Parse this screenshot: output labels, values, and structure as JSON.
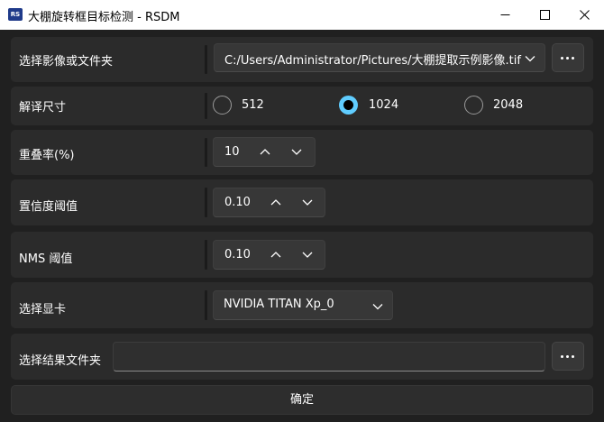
{
  "window": {
    "icon_text": "RS",
    "title": "大棚旋转框目标检测 - RSDM"
  },
  "image_row": {
    "label": "选择影像或文件夹",
    "path_value": "C:/Users/Administrator/Pictures/大棚提取示例影像.tif"
  },
  "resolution_row": {
    "label": "解译尺寸",
    "options": [
      "512",
      "1024",
      "2048"
    ],
    "selected": "1024"
  },
  "overlap_row": {
    "label": "重叠率(%)",
    "value": "10"
  },
  "confidence_row": {
    "label": "置信度阈值",
    "value": "0.10"
  },
  "nms_row": {
    "label": "NMS 阈值",
    "value": "0.10"
  },
  "gpu_row": {
    "label": "选择显卡",
    "value": "NVIDIA TITAN Xp_0"
  },
  "output_row": {
    "label": "选择结果文件夹",
    "value": ""
  },
  "confirm_button": {
    "label": "确定"
  },
  "colors": {
    "accent": "#60cdff",
    "background": "#202020",
    "row_background": "#2b2b2b",
    "control_background": "#373737"
  }
}
